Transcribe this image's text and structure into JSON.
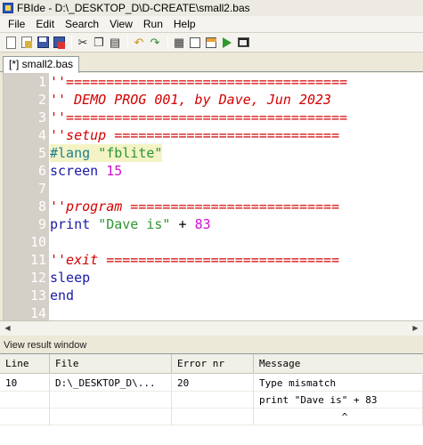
{
  "window": {
    "title": "FBIde - D:\\_DESKTOP_D\\D-CREATE\\small2.bas",
    "icon": "fbide-app-icon"
  },
  "menu": [
    "File",
    "Edit",
    "Search",
    "View",
    "Run",
    "Help"
  ],
  "toolbar": {
    "buttons": [
      "new-file-icon",
      "open-file-icon",
      "save-icon",
      "close-file-icon",
      "cut-icon",
      "copy-icon",
      "paste-icon",
      "undo-icon",
      "redo-icon",
      "window-icon",
      "window-split-icon",
      "compile-icon",
      "run-icon",
      "terminal-icon"
    ]
  },
  "editor": {
    "tab_label": "[*] small2.bas",
    "lines": [
      {
        "n": "1",
        "parts": [
          {
            "t": "''===================================",
            "c": "red"
          }
        ]
      },
      {
        "n": "2",
        "parts": [
          {
            "t": "'' DEMO PROG 001, by Dave, Jun 2023",
            "c": "red"
          }
        ]
      },
      {
        "n": "3",
        "parts": [
          {
            "t": "''===================================",
            "c": "red"
          }
        ]
      },
      {
        "n": "4",
        "parts": [
          {
            "t": "''setup ============================",
            "c": "red"
          }
        ]
      },
      {
        "n": "5",
        "parts": [
          {
            "t": "#lang ",
            "c": "teal"
          },
          {
            "t": "\"fblite\"",
            "c": "str"
          }
        ],
        "highlight": true
      },
      {
        "n": "6",
        "parts": [
          {
            "t": "screen ",
            "c": "kw"
          },
          {
            "t": "15",
            "c": "num"
          }
        ]
      },
      {
        "n": "7",
        "parts": []
      },
      {
        "n": "8",
        "parts": [
          {
            "t": "''program ==========================",
            "c": "red"
          }
        ]
      },
      {
        "n": "9",
        "parts": [
          {
            "t": "print ",
            "c": "kw"
          },
          {
            "t": "\"Dave is\"",
            "c": "str"
          },
          {
            "t": " + ",
            "c": "plain"
          },
          {
            "t": "83",
            "c": "num"
          }
        ]
      },
      {
        "n": "10",
        "parts": []
      },
      {
        "n": "11",
        "parts": [
          {
            "t": "''exit =============================",
            "c": "red"
          }
        ]
      },
      {
        "n": "12",
        "parts": [
          {
            "t": "sleep",
            "c": "kw"
          }
        ]
      },
      {
        "n": "13",
        "parts": [
          {
            "t": "end",
            "c": "kw"
          }
        ]
      },
      {
        "n": "14",
        "parts": []
      }
    ],
    "colors": {
      "comment": "#d40000",
      "keyword": "#1a1aa6",
      "directive": "#1f7f8f",
      "string": "#2f9632",
      "number": "#d10fd1",
      "gutter": "#d4d0c8",
      "highlight_line": "#f3f3c6"
    }
  },
  "result": {
    "title": "View result window",
    "columns": [
      "Line",
      "File",
      "Error nr",
      "Message"
    ],
    "rows": [
      [
        "10",
        "D:\\_DESKTOP_D\\...",
        "20",
        "Type mismatch"
      ],
      [
        "",
        "",
        "",
        "print \"Dave is\" + 83"
      ],
      [
        "",
        "",
        "",
        "              ^"
      ]
    ]
  }
}
